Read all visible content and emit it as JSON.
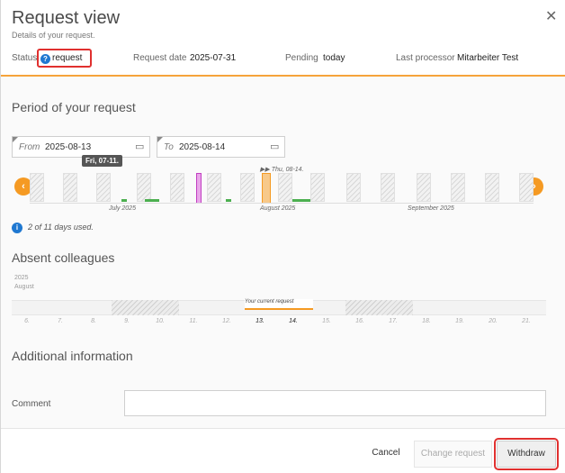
{
  "header": {
    "title": "Request view",
    "subtitle": "Details of your request.",
    "status_label": "Status",
    "status_value": "request",
    "request_date_label": "Request date",
    "request_date_value": "2025-07-31",
    "pending_label": "Pending",
    "pending_value": "today",
    "last_processor_label": "Last processor",
    "last_processor_value": "Mitarbeiter Test"
  },
  "period": {
    "title": "Period of your request",
    "from_label": "From",
    "from_value": "2025-08-13",
    "to_label": "To",
    "to_value": "2025-08-14",
    "tooltip": "Fri, 07-11.",
    "marker": "▶▶ Thu, 08-14.",
    "months": [
      "July 2025",
      "August 2025",
      "September 2025"
    ],
    "days_used": "2 of 11 days used."
  },
  "absent": {
    "title": "Absent colleagues",
    "year": "2025",
    "month": "August",
    "current_request": "Your current request",
    "days": [
      "6.",
      "7.",
      "8.",
      "9.",
      "10.",
      "11.",
      "12.",
      "13.",
      "14.",
      "15.",
      "16.",
      "17.",
      "18.",
      "19.",
      "20.",
      "21."
    ]
  },
  "additional": {
    "title": "Additional information",
    "comment_label": "Comment",
    "comment_value": ""
  },
  "footer": {
    "cancel": "Cancel",
    "change": "Change request",
    "withdraw": "Withdraw"
  },
  "colors": {
    "accent": "#f59a23",
    "info": "#1f78d1",
    "highlight": "#e0302f",
    "used": "#4caf50",
    "holiday": "#c23ec2"
  }
}
